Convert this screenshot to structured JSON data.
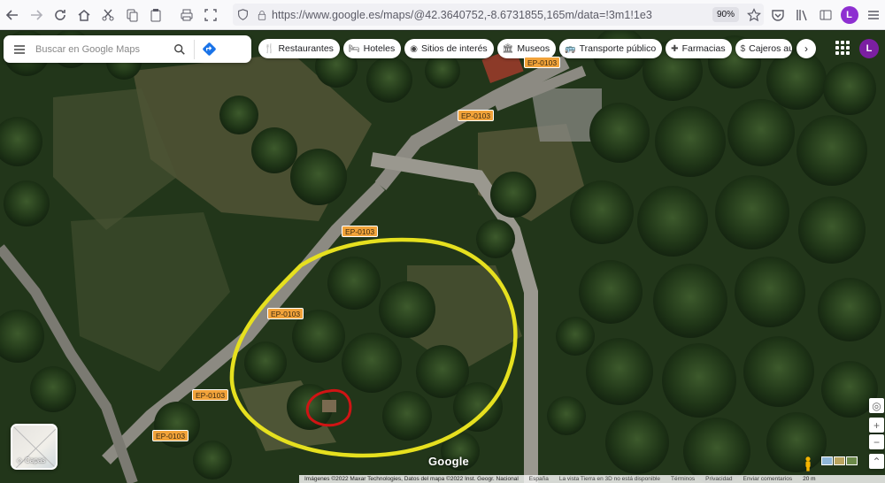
{
  "browser": {
    "url": "https://www.google.es/maps/@42.3640752,-8.6731855,165m/data=!3m1!1e3",
    "zoom": "90%",
    "profile_initial": "L",
    "icons": [
      "back-arrow-icon",
      "forward-arrow-icon",
      "reload-icon",
      "home-icon",
      "cut-icon",
      "copy-icon",
      "paste-icon",
      "print-icon",
      "screenshot-icon",
      "shield-icon",
      "lock-icon",
      "star-icon",
      "pocket-icon",
      "library-icon",
      "sidebar-icon",
      "menu-icon"
    ]
  },
  "search": {
    "placeholder": "Buscar en Google Maps"
  },
  "categories": [
    {
      "label": "Restaurantes",
      "icon": "restaurant-icon"
    },
    {
      "label": "Hoteles",
      "icon": "hotel-icon"
    },
    {
      "label": "Sitios de interés",
      "icon": "camera-icon"
    },
    {
      "label": "Museos",
      "icon": "museum-icon"
    },
    {
      "label": "Transporte público",
      "icon": "bus-icon"
    },
    {
      "label": "Farmacias",
      "icon": "pharmacy-icon"
    },
    {
      "label": "Cajeros au",
      "icon": "atm-icon"
    }
  ],
  "account_initial": "L",
  "road_labels": {
    "r1": "EP-0103",
    "r2": "EP-0103",
    "r3": "EP-0103",
    "r4": "EP-0103",
    "r5": "EP-0103",
    "r6": "EP-0103"
  },
  "layers_label": "Capas",
  "logo": "Google",
  "footer": {
    "imagery": "Imágenes ©2022 Maxar Technologies, Datos del mapa ©2022 Inst. Geogr. Nacional",
    "country": "España",
    "notice": "La vista Tierra en 3D no está disponible",
    "terms": "Términos",
    "privacy": "Privacidad",
    "feedback": "Enviar comentarios",
    "scale": "20 m"
  }
}
